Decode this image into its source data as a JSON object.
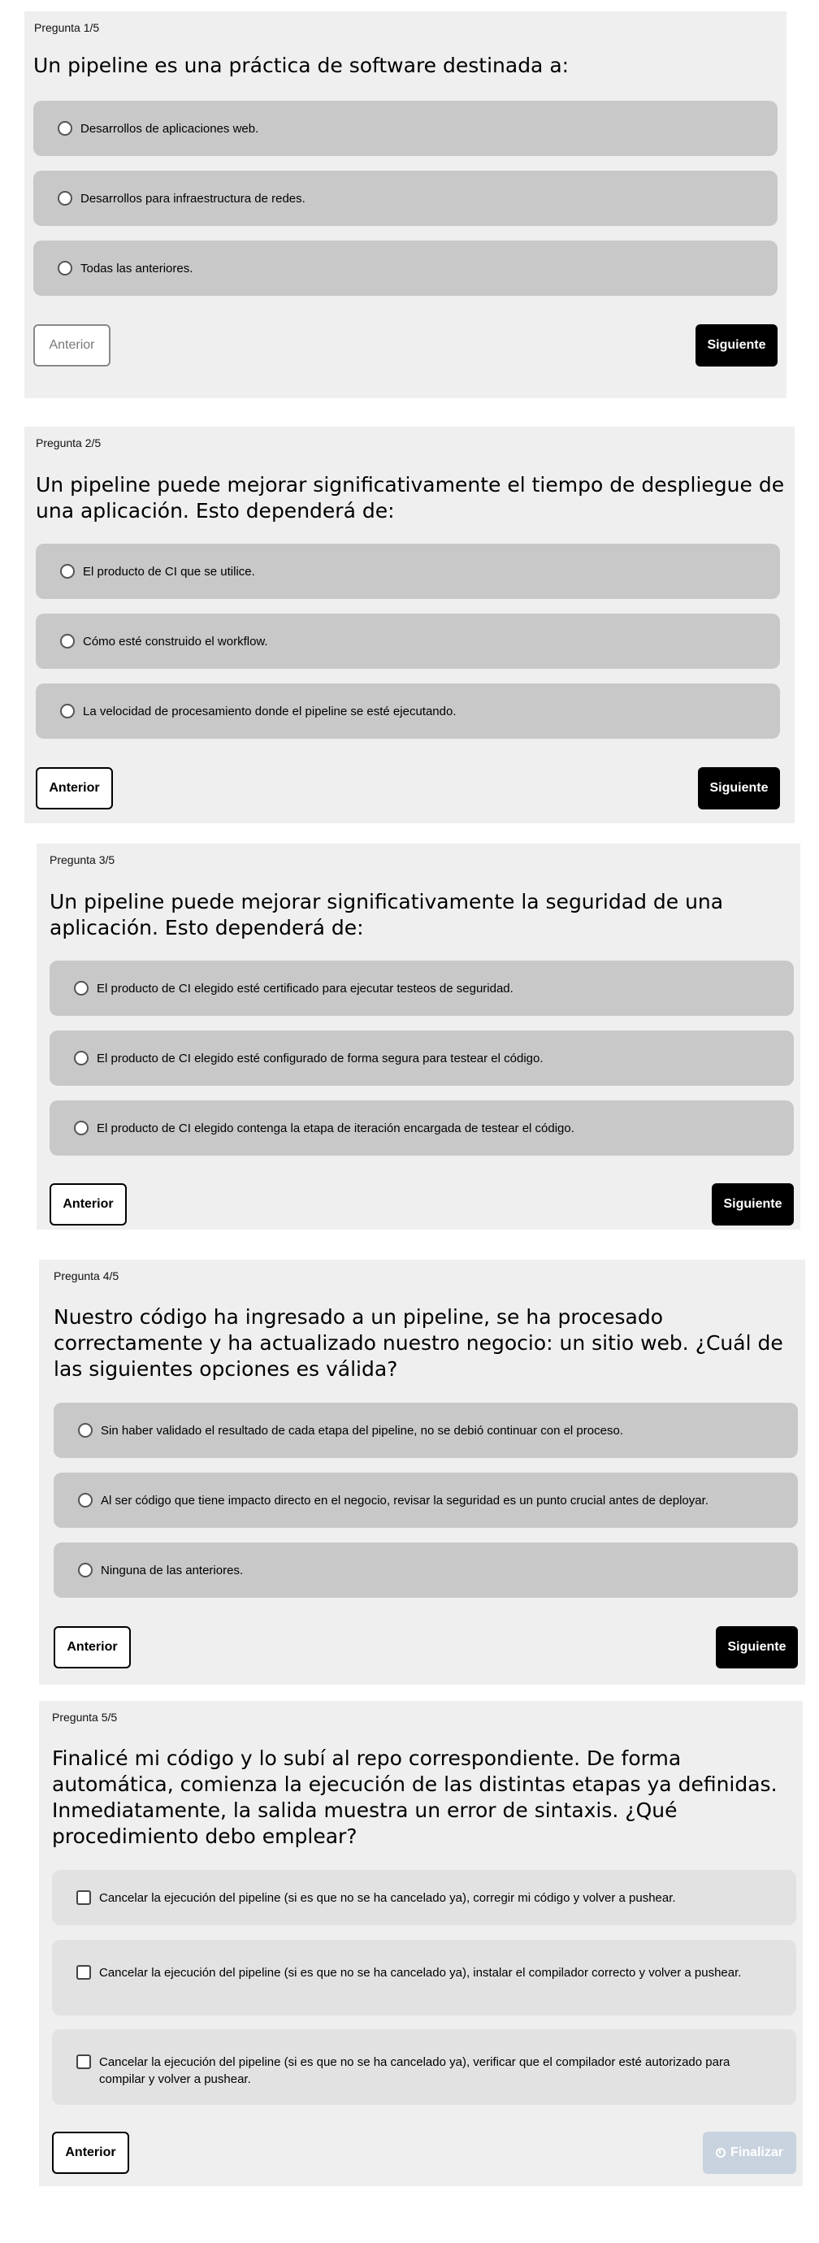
{
  "questions": [
    {
      "counter": "Pregunta 1/5",
      "text": "Un pipeline es una práctica de software destinada a:",
      "options": [
        "Desarrollos de aplicaciones web.",
        "Desarrollos para infraestructura de redes.",
        "Todas las anteriores."
      ],
      "prev_label": "Anterior",
      "next_label": "Siguiente"
    },
    {
      "counter": "Pregunta 2/5",
      "text": "Un pipeline puede mejorar significativamente el tiempo de despliegue de una aplicación. Esto dependerá de:",
      "options": [
        "El producto de CI que se utilice.",
        "Cómo esté construido el workflow.",
        "La velocidad de procesamiento donde el pipeline se esté ejecutando."
      ],
      "prev_label": "Anterior",
      "next_label": "Siguiente"
    },
    {
      "counter": "Pregunta 3/5",
      "text": "Un pipeline puede mejorar significativamente la seguridad de una aplicación. Esto dependerá de:",
      "options": [
        "El producto de CI elegido esté certificado para ejecutar testeos de seguridad.",
        "El producto de CI elegido esté configurado de forma segura para testear el código.",
        "El producto de CI elegido contenga la etapa de iteración encargada de testear el código."
      ],
      "prev_label": "Anterior",
      "next_label": "Siguiente"
    },
    {
      "counter": "Pregunta 4/5",
      "text": "Nuestro código ha ingresado a un pipeline, se ha procesado correctamente y ha actualizado nuestro negocio: un sitio web. ¿Cuál de las siguientes opciones es válida?",
      "options": [
        "Sin haber validado el resultado de cada etapa del pipeline, no se debió continuar con el proceso.",
        "Al ser código que tiene impacto directo en el negocio, revisar la seguridad es un punto crucial antes de deployar.",
        "Ninguna de las anteriores."
      ],
      "prev_label": "Anterior",
      "next_label": "Siguiente"
    },
    {
      "counter": "Pregunta 5/5",
      "text": "Finalicé mi código y lo subí al repo correspondiente. De forma automática, comienza la ejecución de las distintas etapas ya definidas. Inmediatamente, la salida muestra un error de sintaxis. ¿Qué procedimiento debo emplear?",
      "options": [
        "Cancelar la ejecución del pipeline (si es que no se ha cancelado ya), corregir mi código y volver a pushear.",
        "Cancelar la ejecución del pipeline (si es que no se ha cancelado ya), instalar el compilador correcto y volver a pushear.",
        "Cancelar la ejecución del pipeline (si es que no se ha cancelado ya), verificar que el compilador esté autorizado para compilar y volver a pushear."
      ],
      "prev_label": "Anterior",
      "finish_label": "Finalizar"
    }
  ],
  "colors": {
    "card_bg": "#efefef",
    "option_bg": "#c8c8c8",
    "option_bg_checkbox": "#e2e2e2",
    "primary_button": "#000000",
    "finish_button_disabled": "#c9d3df"
  },
  "icons": {
    "finish": "clock-icon"
  }
}
